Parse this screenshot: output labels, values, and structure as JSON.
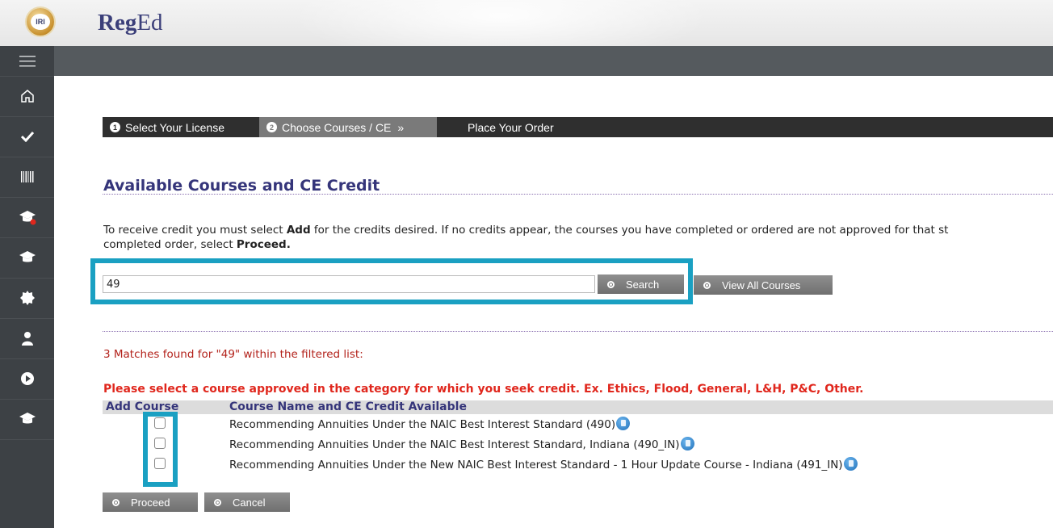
{
  "header": {
    "logo_badge_text": "IRI",
    "brand_bold": "Reg",
    "brand_rest": "Ed"
  },
  "sidebar": {
    "items": [
      {
        "icon": "menu-icon"
      },
      {
        "icon": "home-icon"
      },
      {
        "icon": "checkmark-icon"
      },
      {
        "icon": "barcode-icon"
      },
      {
        "icon": "graduation-cap-alert-icon"
      },
      {
        "icon": "graduation-cap-icon"
      },
      {
        "icon": "badge-icon"
      },
      {
        "icon": "user-icon"
      },
      {
        "icon": "play-icon"
      },
      {
        "icon": "graduation-cap-icon"
      }
    ]
  },
  "steps": [
    {
      "num": "1",
      "label": "Select Your License"
    },
    {
      "num": "2",
      "label": "Choose Courses / CE",
      "arrow": "»"
    },
    {
      "label": "Place Your Order"
    }
  ],
  "page": {
    "title": "Available Courses and CE Credit",
    "intro_1a": "To receive credit you must select ",
    "intro_1b": "Add",
    "intro_1c": " for the credits desired. If no credits appear, the courses you have completed or ordered are not approved for that st",
    "intro_2a": "completed order, select ",
    "intro_2b": "Proceed."
  },
  "search": {
    "value": "49",
    "search_label": "Search",
    "view_all_label": "View All Courses"
  },
  "results": {
    "matches_text": "3 Matches found for \"49\" within the filtered list:",
    "warning_text": "Please select a course approved in the category for which you seek credit. Ex. Ethics, Flood, General, L&H, P&C, Other.",
    "col_add": "Add Course",
    "col_name": "Course Name and CE Credit Available",
    "rows": [
      {
        "name": "Recommending Annuities Under the NAIC Best Interest Standard (490)",
        "checked": false
      },
      {
        "name": "Recommending Annuities Under the NAIC Best Interest Standard, Indiana (490_IN)",
        "checked": false
      },
      {
        "name": "Recommending Annuities Under the New NAIC Best Interest Standard - 1 Hour Update Course - Indiana (491_IN)",
        "checked": false
      }
    ]
  },
  "actions": {
    "proceed_label": "Proceed",
    "cancel_label": "Cancel"
  },
  "colors": {
    "highlight": "#1aa0c2",
    "title": "#35357a",
    "warning": "#e0271d",
    "sidebar": "#3d4145"
  }
}
